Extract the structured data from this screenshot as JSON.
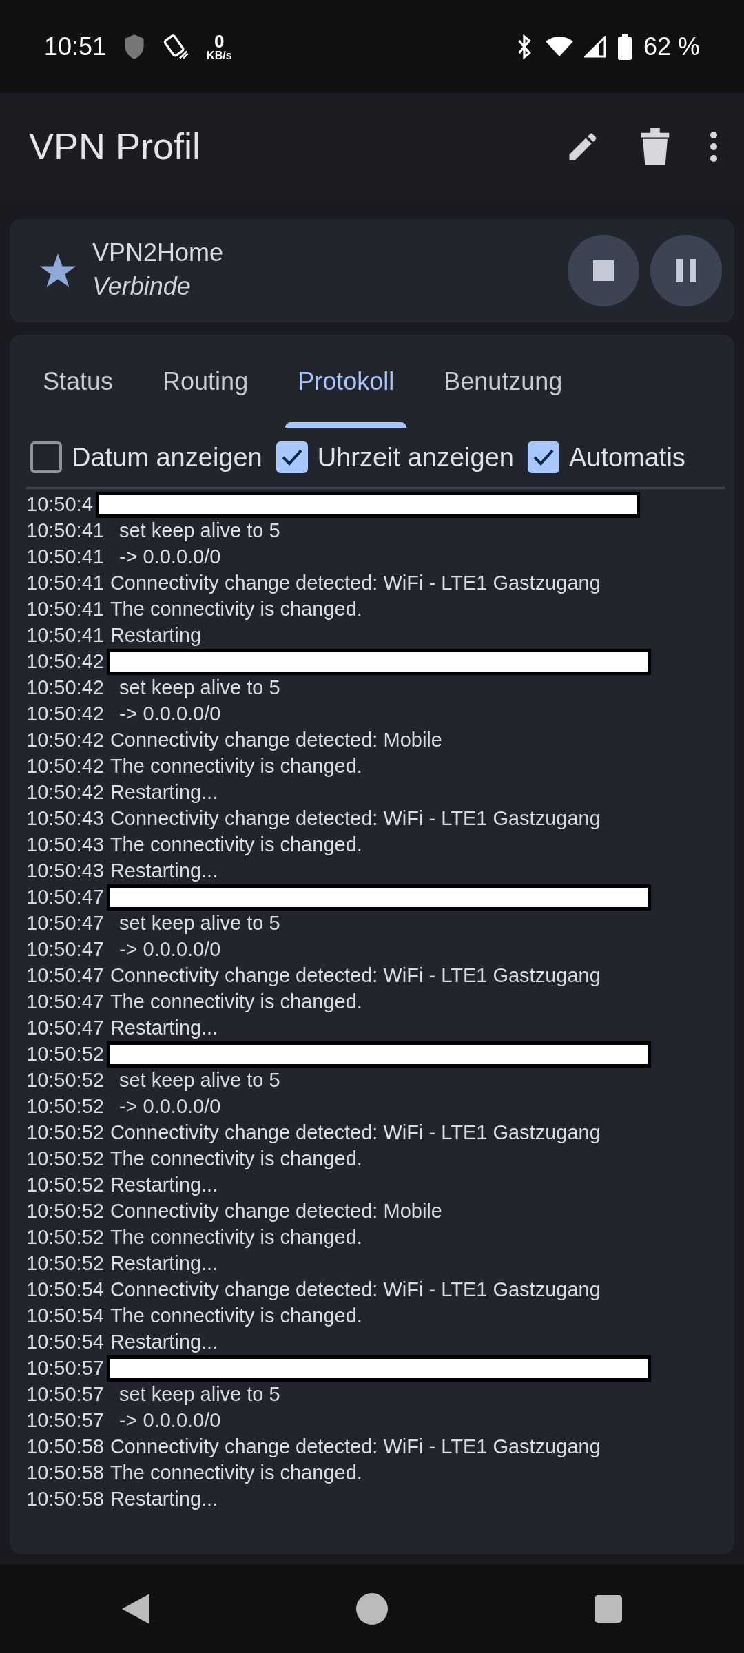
{
  "status_bar": {
    "time": "10:51",
    "speed_value": "0",
    "speed_unit": "KB/s",
    "battery": "62 %"
  },
  "app_bar": {
    "title": "VPN Profil"
  },
  "profile": {
    "name": "VPN2Home",
    "state": "Verbinde"
  },
  "tabs": [
    {
      "label": "Status",
      "selected": false
    },
    {
      "label": "Routing",
      "selected": false
    },
    {
      "label": "Protokoll",
      "selected": true
    },
    {
      "label": "Benutzung",
      "selected": false
    }
  ],
  "options": [
    {
      "label": "Datum anzeigen",
      "checked": false
    },
    {
      "label": "Uhrzeit anzeigen",
      "checked": true
    },
    {
      "label": "Automatis",
      "checked": true
    }
  ],
  "log": [
    {
      "time": "10:50:4",
      "redacted": true
    },
    {
      "time": "10:50:41",
      "message": "set keep alive to 5",
      "indented": true
    },
    {
      "time": "10:50:41",
      "message": "-> 0.0.0.0/0",
      "indented": true
    },
    {
      "time": "10:50:41",
      "message": "Connectivity change detected: WiFi - LTE1 Gastzugang"
    },
    {
      "time": "10:50:41",
      "message": "The connectivity is changed."
    },
    {
      "time": "10:50:41",
      "message": "Restarting"
    },
    {
      "time": "10:50:42",
      "redacted": true
    },
    {
      "time": "10:50:42",
      "message": "set keep alive to 5",
      "indented": true
    },
    {
      "time": "10:50:42",
      "message": "-> 0.0.0.0/0",
      "indented": true
    },
    {
      "time": "10:50:42",
      "message": "Connectivity change detected: Mobile"
    },
    {
      "time": "10:50:42",
      "message": "The connectivity is changed."
    },
    {
      "time": "10:50:42",
      "message": "Restarting..."
    },
    {
      "time": "10:50:43",
      "message": "Connectivity change detected: WiFi - LTE1 Gastzugang"
    },
    {
      "time": "10:50:43",
      "message": "The connectivity is changed."
    },
    {
      "time": "10:50:43",
      "message": "Restarting..."
    },
    {
      "time": "10:50:47",
      "redacted": true
    },
    {
      "time": "10:50:47",
      "message": "set keep alive to 5",
      "indented": true
    },
    {
      "time": "10:50:47",
      "message": "-> 0.0.0.0/0",
      "indented": true
    },
    {
      "time": "10:50:47",
      "message": "Connectivity change detected: WiFi - LTE1 Gastzugang"
    },
    {
      "time": "10:50:47",
      "message": "The connectivity is changed."
    },
    {
      "time": "10:50:47",
      "message": "Restarting..."
    },
    {
      "time": "10:50:52",
      "redacted": true
    },
    {
      "time": "10:50:52",
      "message": "set keep alive to 5",
      "indented": true
    },
    {
      "time": "10:50:52",
      "message": "-> 0.0.0.0/0",
      "indented": true
    },
    {
      "time": "10:50:52",
      "message": "Connectivity change detected: WiFi - LTE1 Gastzugang"
    },
    {
      "time": "10:50:52",
      "message": "The connectivity is changed."
    },
    {
      "time": "10:50:52",
      "message": "Restarting..."
    },
    {
      "time": "10:50:52",
      "message": "Connectivity change detected: Mobile"
    },
    {
      "time": "10:50:52",
      "message": "The connectivity is changed."
    },
    {
      "time": "10:50:52",
      "message": "Restarting..."
    },
    {
      "time": "10:50:54",
      "message": "Connectivity change detected: WiFi - LTE1 Gastzugang"
    },
    {
      "time": "10:50:54",
      "message": "The connectivity is changed."
    },
    {
      "time": "10:50:54",
      "message": "Restarting..."
    },
    {
      "time": "10:50:57",
      "redacted": true
    },
    {
      "time": "10:50:57",
      "message": "set keep alive to 5",
      "indented": true
    },
    {
      "time": "10:50:57",
      "message": "-> 0.0.0.0/0",
      "indented": true
    },
    {
      "time": "10:50:58",
      "message": "Connectivity change detected: WiFi - LTE1 Gastzugang"
    },
    {
      "time": "10:50:58",
      "message": "The connectivity is changed."
    },
    {
      "time": "10:50:58",
      "message": "Restarting..."
    }
  ]
}
